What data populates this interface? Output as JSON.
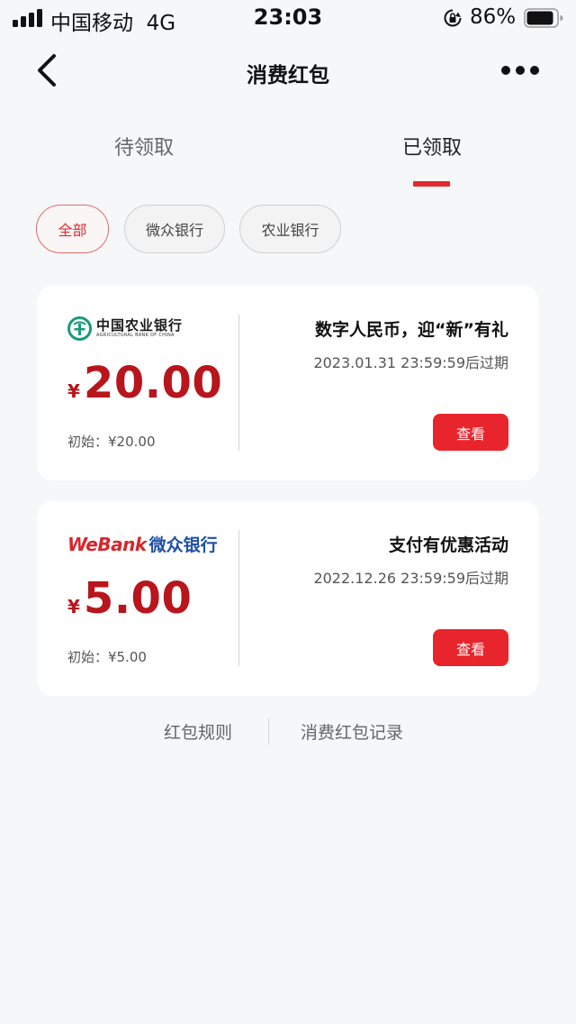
{
  "status_bar": {
    "carrier": "中国移动",
    "network": "4G",
    "time": "23:03",
    "battery_percent": "86%"
  },
  "nav": {
    "title": "消费红包"
  },
  "tabs": [
    {
      "label": "待领取",
      "active": false
    },
    {
      "label": "已领取",
      "active": true
    }
  ],
  "filters": [
    {
      "label": "全部",
      "selected": true
    },
    {
      "label": "微众银行",
      "selected": false
    },
    {
      "label": "农业银行",
      "selected": false
    }
  ],
  "cards": [
    {
      "bank_name": "中国农业银行",
      "bank_name_en": "AGRICULTURAL BANK OF CHINA",
      "currency": "¥",
      "amount": "20.00",
      "initial": "初始：¥20.00",
      "promo_title": "数字人民币，迎“新”有礼",
      "expiry": "2023.01.31 23:59:59后过期",
      "button_label": "查看"
    },
    {
      "bank_name_en": "WeBank",
      "bank_name": "微众银行",
      "currency": "¥",
      "amount": "5.00",
      "initial": "初始：¥5.00",
      "promo_title": "支付有优惠活动",
      "expiry": "2022.12.26 23:59:59后过期",
      "button_label": "查看"
    }
  ],
  "footer": {
    "rules_label": "红包规则",
    "records_label": "消费红包记录"
  },
  "colors": {
    "accent_red": "#e02a2e",
    "amount_red": "#b8151c",
    "abc_green": "#1a9a7a",
    "webank_red": "#d6262b",
    "webank_blue": "#1f4fa6"
  },
  "icons": [
    "signal-icon",
    "rotation-lock-icon",
    "battery-icon",
    "back-arrow-icon",
    "more-icon",
    "abc-logo-icon"
  ]
}
